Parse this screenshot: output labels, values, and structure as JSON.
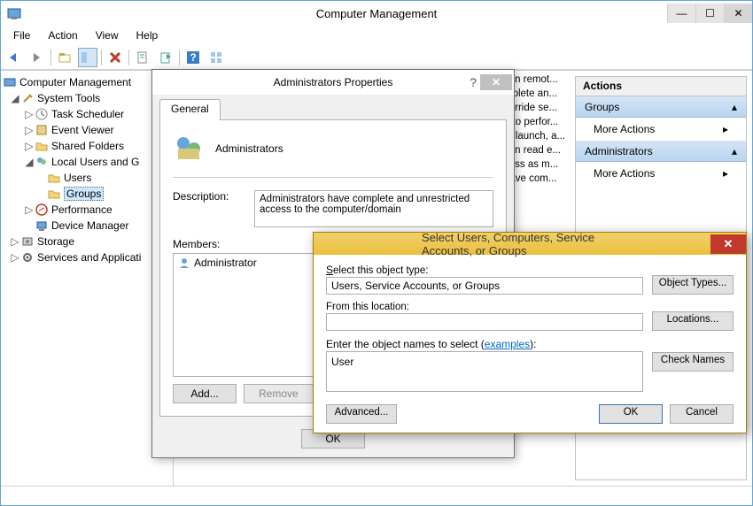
{
  "window": {
    "title": "Computer Management"
  },
  "menu": {
    "file": "File",
    "action": "Action",
    "view": "View",
    "help": "Help"
  },
  "tree": {
    "root": "Computer Management",
    "system_tools": "System Tools",
    "task_scheduler": "Task Scheduler",
    "event_viewer": "Event Viewer",
    "shared_folders": "Shared Folders",
    "local_users_groups": "Local Users and G",
    "users": "Users",
    "groups": "Groups",
    "performance": "Performance",
    "device_manager": "Device Manager",
    "storage": "Storage",
    "services": "Services and Applicati"
  },
  "desc_snips": [
    "can remot...",
    "mplete an...",
    "verride se...",
    "d to perfor...",
    "to launch, a...",
    "can read e...",
    "cess as m...",
    "have com..."
  ],
  "actions": {
    "header": "Actions",
    "group1": "Groups",
    "item1": "More Actions",
    "group2": "Administrators",
    "item2": "More Actions"
  },
  "props": {
    "title": "Administrators Properties",
    "tab_general": "General",
    "group_name": "Administrators",
    "description_label": "Description:",
    "description": "Administrators have complete and unrestricted access to the computer/domain",
    "members_label": "Members:",
    "member1": "Administrator",
    "add": "Add...",
    "remove": "Remove",
    "ok": "OK"
  },
  "select": {
    "title": "Select Users, Computers, Service Accounts, or Groups",
    "object_type_label": "Select this object type:",
    "object_type_value": "Users, Service Accounts, or Groups",
    "object_types_btn": "Object Types...",
    "location_label": "From this location:",
    "location_value": "",
    "locations_btn": "Locations...",
    "names_label_1": "Enter the object names to select (",
    "examples": "examples",
    "names_label_2": "):",
    "names_value": "User",
    "check_names": "Check Names",
    "advanced": "Advanced...",
    "ok": "OK",
    "cancel": "Cancel"
  }
}
